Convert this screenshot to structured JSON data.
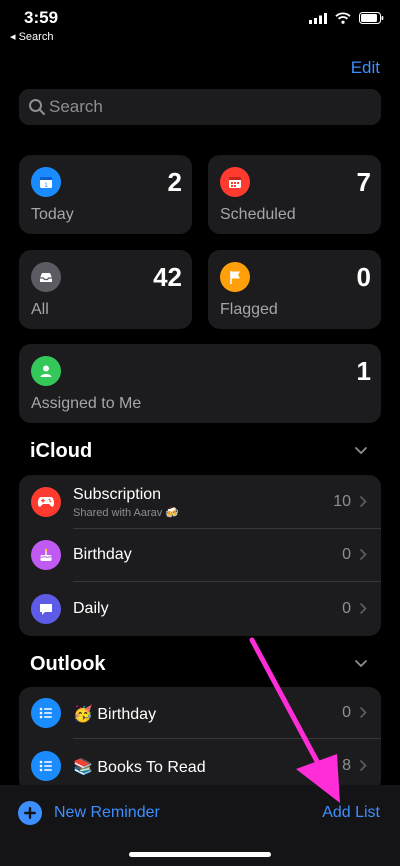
{
  "status_bar": {
    "time": "3:59",
    "back_label": "◂ Search"
  },
  "header": {
    "edit_label": "Edit"
  },
  "search": {
    "placeholder": "Search"
  },
  "smart_lists": {
    "today": {
      "label": "Today",
      "count": "2",
      "color": "#1a8cff"
    },
    "scheduled": {
      "label": "Scheduled",
      "count": "7",
      "color": "#ff3b30"
    },
    "all": {
      "label": "All",
      "count": "42",
      "color": "#5b5b61"
    },
    "flagged": {
      "label": "Flagged",
      "count": "0",
      "color": "#ff9f0a"
    },
    "assigned": {
      "label": "Assigned to Me",
      "count": "1",
      "color": "#34c759"
    }
  },
  "icloud": {
    "title": "iCloud",
    "lists": [
      {
        "title": "Subscription",
        "subtitle": "Shared with Aarav 🍻",
        "count": "10",
        "color": "#ff3b30",
        "icon": "gamepad-icon"
      },
      {
        "title": "Birthday",
        "count": "0",
        "color": "#bf5af2",
        "icon": "cake-icon"
      },
      {
        "title": "Daily",
        "count": "0",
        "color": "#5e5ce6",
        "icon": "speech-bubble-icon"
      }
    ]
  },
  "outlook": {
    "title": "Outlook",
    "lists": [
      {
        "title": "🥳 Birthday",
        "count": "0",
        "color": "#1a8cff",
        "icon": "list-icon"
      },
      {
        "title": "📚 Books To Read",
        "count": "8",
        "color": "#1a8cff",
        "icon": "list-icon"
      }
    ]
  },
  "toolbar": {
    "new_reminder_label": "New Reminder",
    "add_list_label": "Add List"
  },
  "accent_color": "#3d8fff",
  "annotation_color": "#ff2dd8"
}
